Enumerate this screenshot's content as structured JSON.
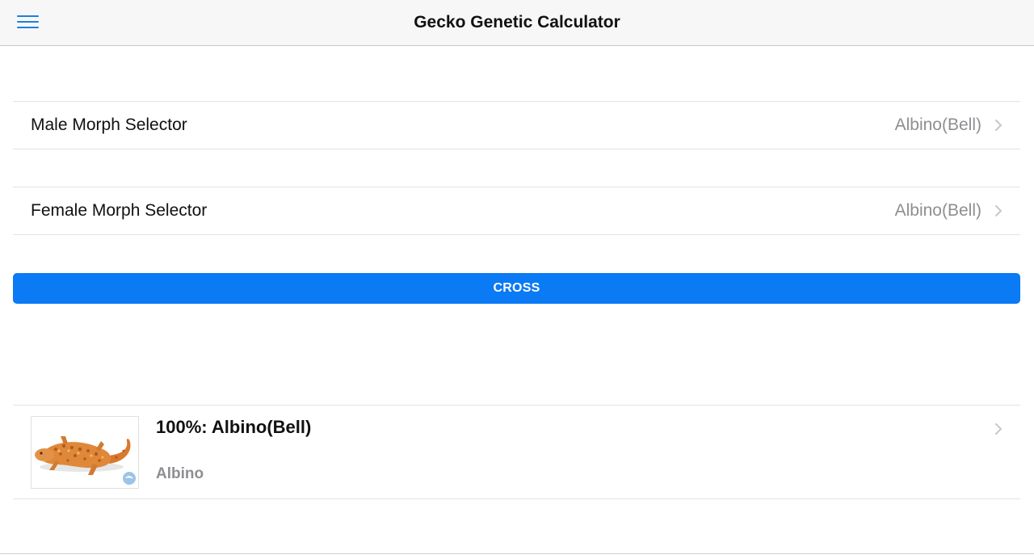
{
  "navbar": {
    "title": "Gecko Genetic Calculator",
    "menu_icon": "hamburger-menu-icon",
    "accent_color": "#1e7fe0"
  },
  "selectors": [
    {
      "label": "Male Morph Selector",
      "value": "Albino(Bell)"
    },
    {
      "label": "Female Morph Selector",
      "value": "Albino(Bell)"
    }
  ],
  "cross_button": {
    "label": "CROSS",
    "color": "#0a7af5"
  },
  "results": [
    {
      "title": "100%: Albino(Bell)",
      "subtitle": "Albino",
      "image_icon": "leopard-gecko-photo"
    }
  ]
}
